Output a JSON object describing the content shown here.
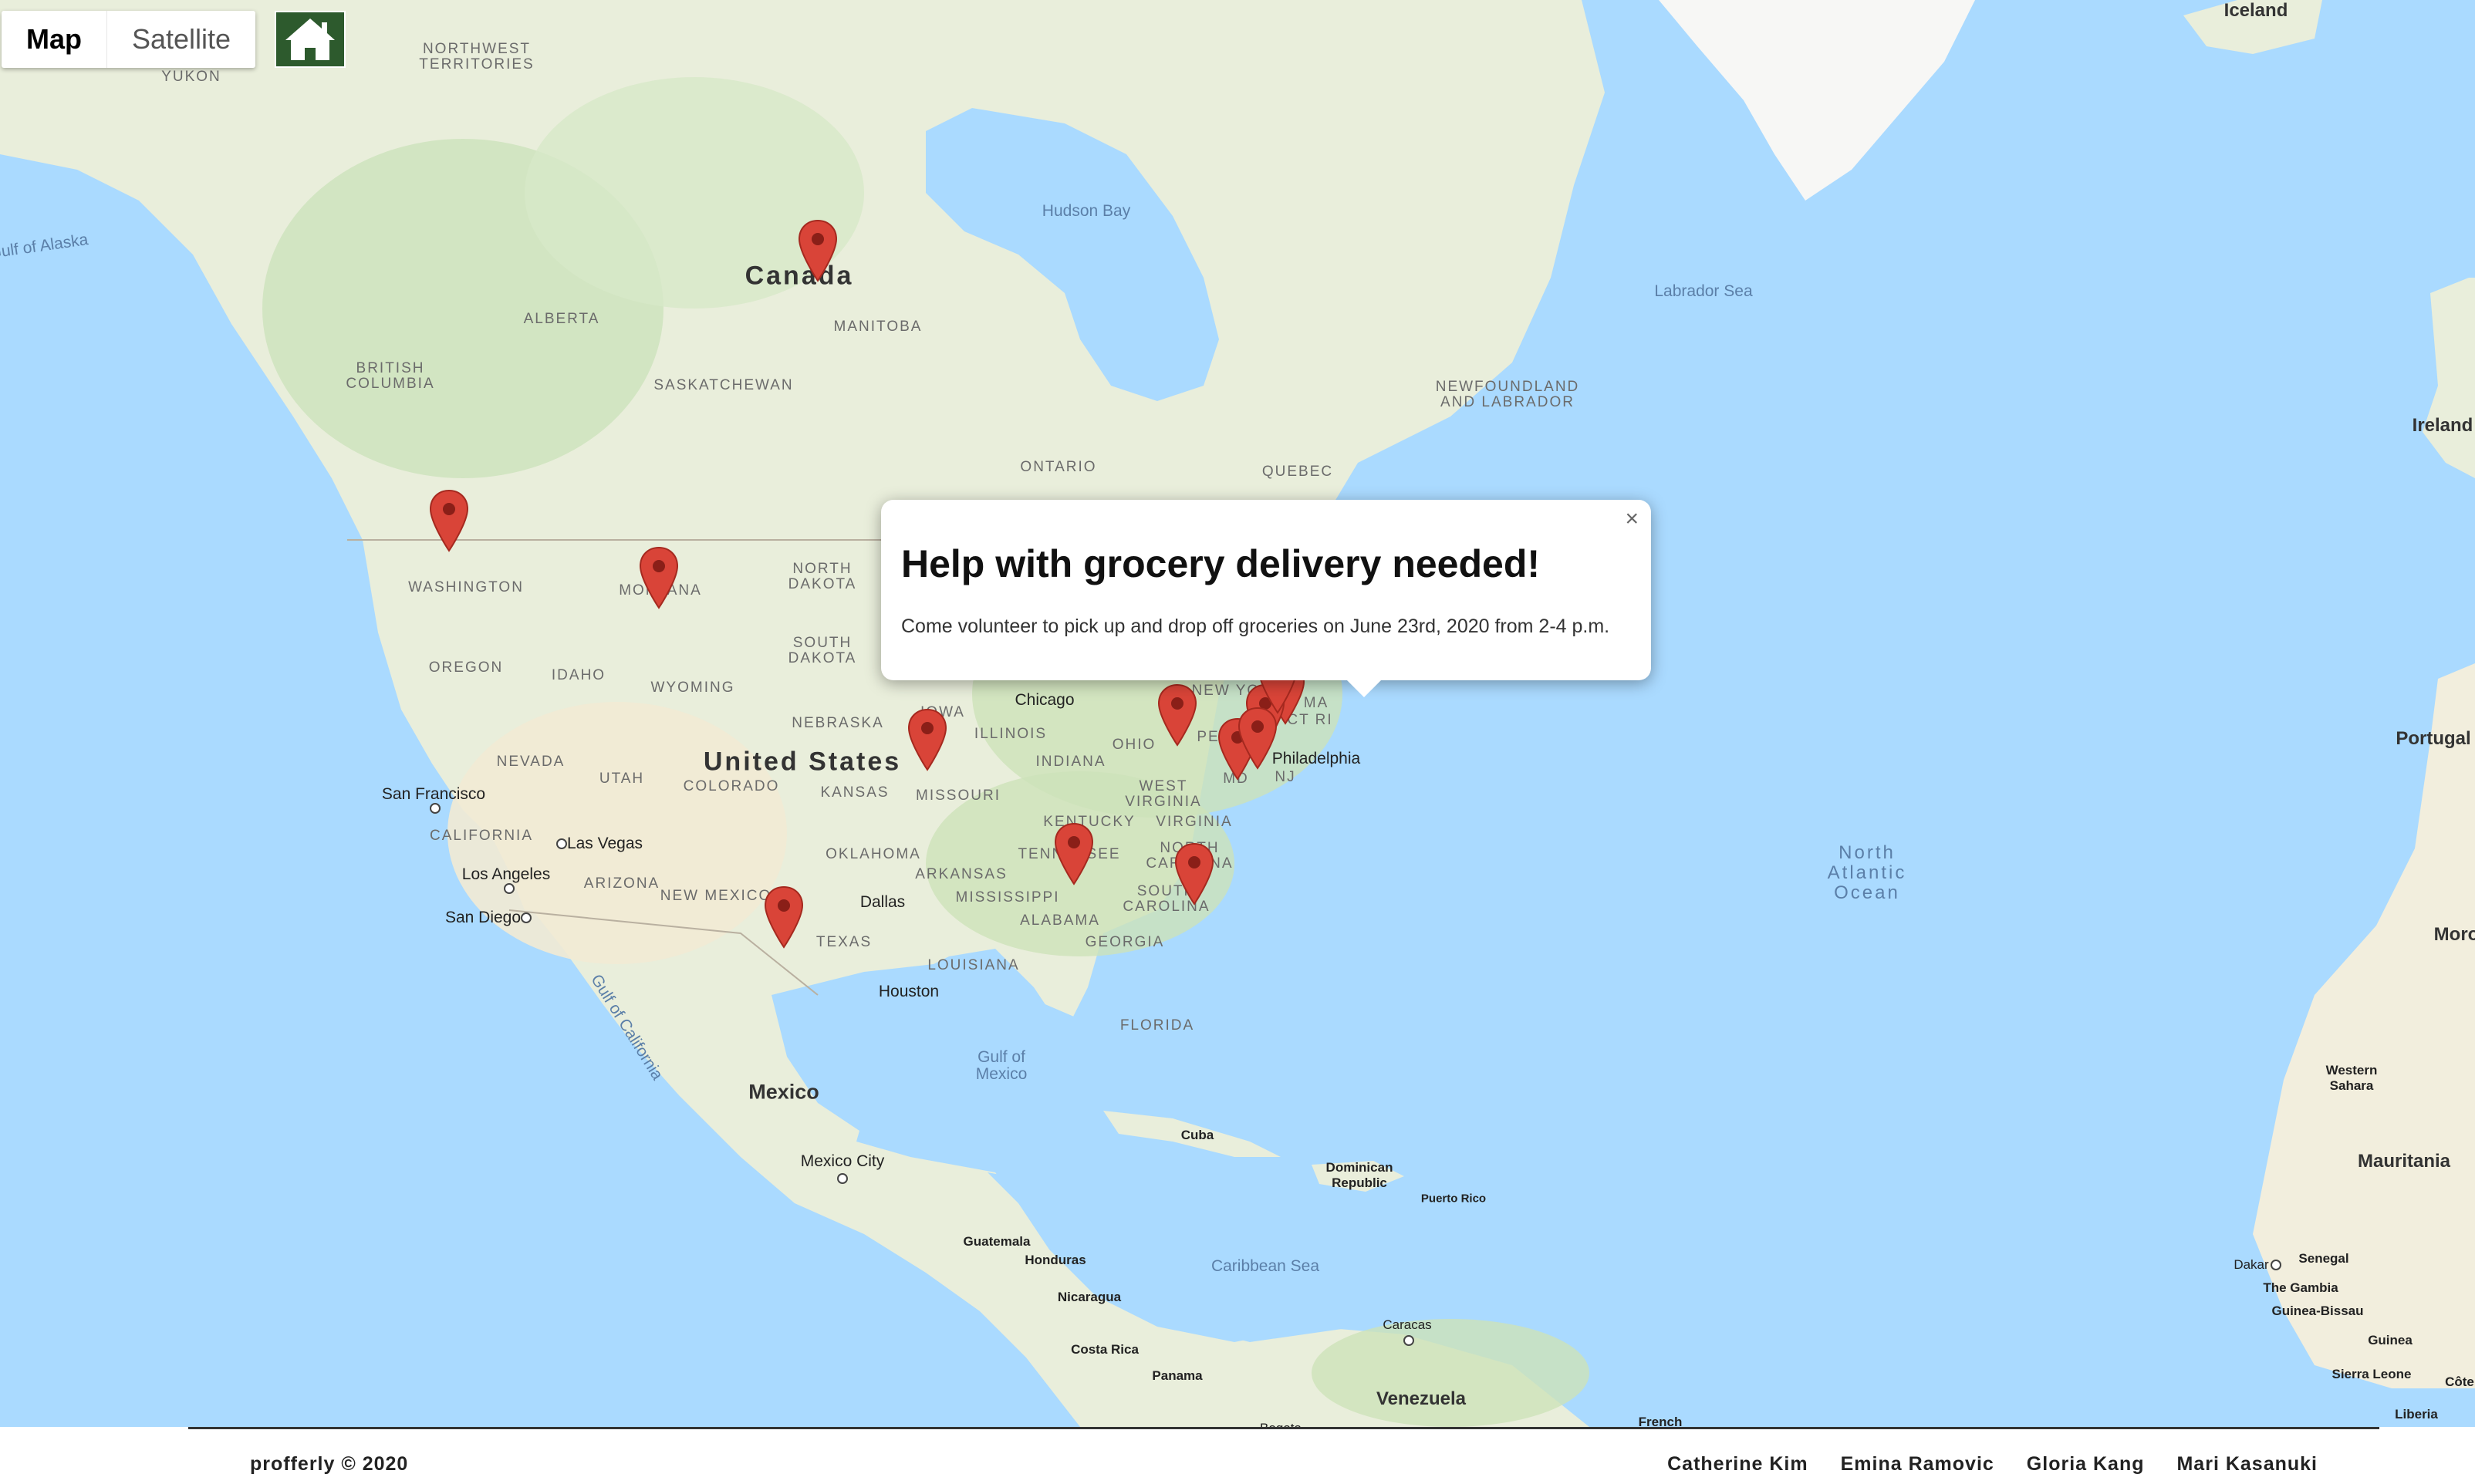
{
  "map_type": {
    "map_label": "Map",
    "satellite_label": "Satellite"
  },
  "home_button": {
    "icon": "home-icon"
  },
  "popup": {
    "title": "Help with grocery delivery needed!",
    "body": "Come volunteer to pick up and drop off groceries on June 23rd, 2020 from 2-4 p.m.",
    "close_symbol": "×"
  },
  "map_labels": {
    "country_canada": "Canada",
    "country_us": "United States",
    "country_mexico": "Mexico",
    "iceland": "Iceland",
    "ireland": "Ireland",
    "portugal": "Portugal",
    "mauritania": "Mauritania",
    "morocco": "Moro",
    "western_sahara": "Western\nSahara",
    "venezuela": "Venezuela",
    "cuba": "Cuba",
    "dominican_republic": "Dominican\nRepublic",
    "puerto_rico": "Puerto Rico",
    "guatemala": "Guatemala",
    "honduras": "Honduras",
    "nicaragua": "Nicaragua",
    "costa_rica": "Costa Rica",
    "panama": "Panama",
    "caracas": "Caracas",
    "bogota": "Bogota",
    "french": "French",
    "dakar": "Dakar",
    "senegal": "Senegal",
    "the_gambia": "The Gambia",
    "guinea_bissau": "Guinea-Bissau",
    "guinea": "Guinea",
    "sierra_leone": "Sierra Leone",
    "liberia": "Liberia",
    "cote": "Côte",
    "yukon": "YUKON",
    "nwt": "NORTHWEST\nTERRITORIES",
    "alberta": "ALBERTA",
    "british_columbia": "BRITISH\nCOLUMBIA",
    "saskatchewan": "SASKATCHEWAN",
    "manitoba": "MANITOBA",
    "ontario": "ONTARIO",
    "quebec": "QUEBEC",
    "newfoundland": "NEWFOUNDLAND\nAND LABRADOR",
    "washington": "WASHINGTON",
    "montana": "MONTANA",
    "north_dakota": "NORTH\nDAKOTA",
    "south_dakota": "SOUTH\nDAKOTA",
    "oregon": "OREGON",
    "idaho": "IDAHO",
    "wyoming": "WYOMING",
    "nebraska": "NEBRASKA",
    "iowa": "IOWA",
    "illinois": "ILLINOIS",
    "ohio": "OHIO",
    "indiana": "INDIANA",
    "nevada": "NEVADA",
    "utah": "UTAH",
    "colorado": "COLORADO",
    "kansas": "KANSAS",
    "missouri": "MISSOURI",
    "california": "CALIFORNIA",
    "arizona": "ARIZONA",
    "new_mexico": "NEW MEXICO",
    "oklahoma": "OKLAHOMA",
    "arkansas": "ARKANSAS",
    "texas": "TEXAS",
    "louisiana": "LOUISIANA",
    "mississippi": "MISSISSIPPI",
    "alabama": "ALABAMA",
    "georgia": "GEORGIA",
    "florida": "FLORIDA",
    "tennessee": "TENNESSEE",
    "kentucky": "KENTUCKY",
    "west_virginia": "WEST\nVIRGINIA",
    "virginia": "VIRGINIA",
    "north_carolina": "NORTH\nCAROLINA",
    "south_carolina": "SOUTH\nCAROLINA",
    "new_york": "NEW YORK",
    "pennsylvania": "PE",
    "nj": "NJ",
    "md": "MD",
    "ct_ri": "CT RI",
    "ma": "MA",
    "chicago": "Chicago",
    "philadelphia": "Philadelphia",
    "san_francisco": "San Francisco",
    "las_vegas": "Las Vegas",
    "los_angeles": "Los Angeles",
    "san_diego": "San Diego",
    "dallas": "Dallas",
    "houston": "Houston",
    "mexico_city": "Mexico City",
    "hudson_bay": "Hudson Bay",
    "labrador_sea": "Labrador Sea",
    "gulf_of_alaska": "Gulf of Alaska",
    "gulf_of_mexico": "Gulf of\nMexico",
    "caribbean_sea": "Caribbean Sea",
    "gulf_of_california": "Gulf of California",
    "north_atlantic": "North\nAtlantic\nOcean"
  },
  "pins_count": 13,
  "colors": {
    "pin": "#d94438",
    "pin_dark": "#8a1f18",
    "water": "#aadaff",
    "land": "#e8efdc",
    "home_bg": "#2d5a2d"
  },
  "footer": {
    "copyright": "profferly © 2020",
    "names": [
      "Catherine Kim",
      "Emina Ramovic",
      "Gloria Kang",
      "Mari Kasanuki"
    ]
  }
}
